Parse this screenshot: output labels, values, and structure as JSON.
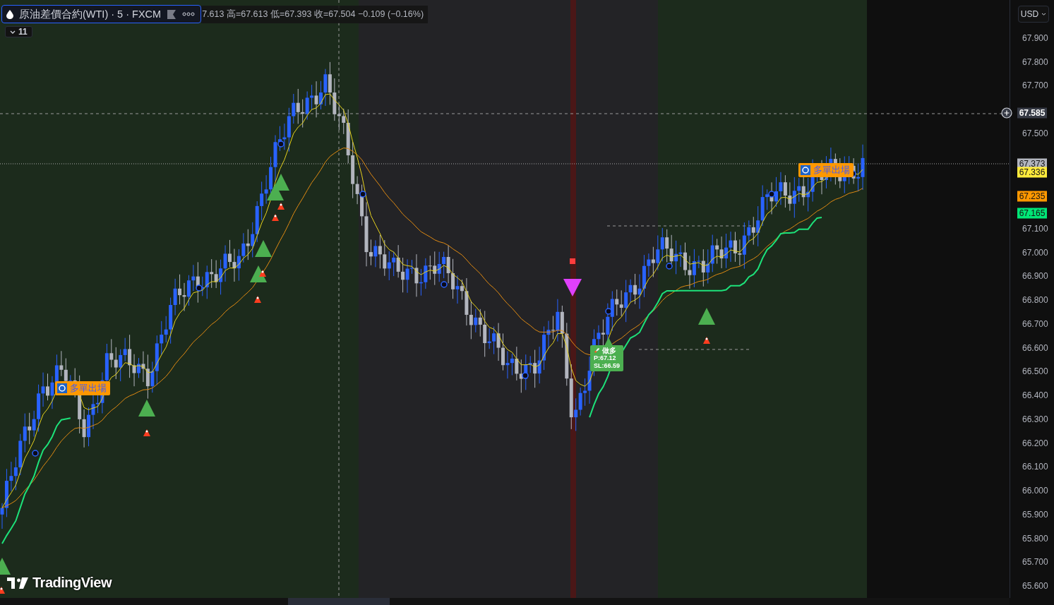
{
  "legend": {
    "symbol": "原油差價合約(WTI) · 5 · FXCM",
    "ohlc": "7.613 高=67.613 低=67.393 收=67.504 −0.109 (−0.16%)",
    "indicator_count": "11"
  },
  "currency": "USD",
  "price_axis": {
    "ticks": [
      "67.900",
      "67.800",
      "67.700",
      "67.500",
      "67.100",
      "67.000",
      "66.900",
      "66.800",
      "66.700",
      "66.600",
      "66.500",
      "66.400",
      "66.300",
      "66.200",
      "66.100",
      "66.000",
      "65.900",
      "65.800",
      "65.700",
      "65.600"
    ],
    "markers": [
      {
        "kind": "crosshair",
        "text": "67.585",
        "color": "#363a45"
      },
      {
        "kind": "price",
        "text": "67.373",
        "color": "#b2b5be"
      },
      {
        "kind": "price",
        "text": "67.336",
        "color": "#ffeb3b"
      },
      {
        "kind": "price",
        "text": "67.235",
        "color": "#ff9800"
      },
      {
        "kind": "price",
        "text": "67.165",
        "color": "#00e676"
      }
    ]
  },
  "signals": [
    {
      "kind": "exit",
      "text": "多單出場"
    },
    {
      "kind": "exit",
      "text": "多單出場"
    },
    {
      "kind": "entry",
      "title": "做多",
      "lines": [
        "P:67.12",
        "SL:66.59"
      ]
    }
  ],
  "branding": "TradingView"
}
